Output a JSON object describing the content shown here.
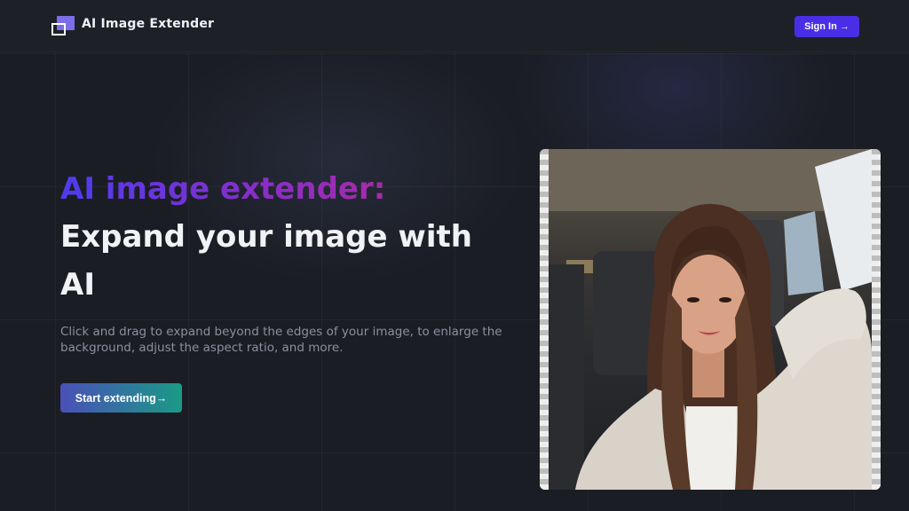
{
  "header": {
    "brand": "AI Image Extender",
    "sign_in_label": "Sign In →"
  },
  "hero": {
    "title_accent": "AI image extender:",
    "title_main": "Expand your image with AI",
    "subtitle": "Click and drag to expand beyond the edges of your image, to enlarge the background, adjust the aspect ratio, and more.",
    "cta_label": "Start extending→"
  },
  "colors": {
    "background": "#1b1d24",
    "sign_in_button": "#4a2ee6",
    "accent_gradient_start": "#4d3cf0",
    "accent_gradient_end": "#c42b86",
    "cta_gradient_start": "#4a50b8",
    "cta_gradient_end": "#1a9a86"
  },
  "icons": {
    "logo": "overlapping-squares-icon"
  }
}
